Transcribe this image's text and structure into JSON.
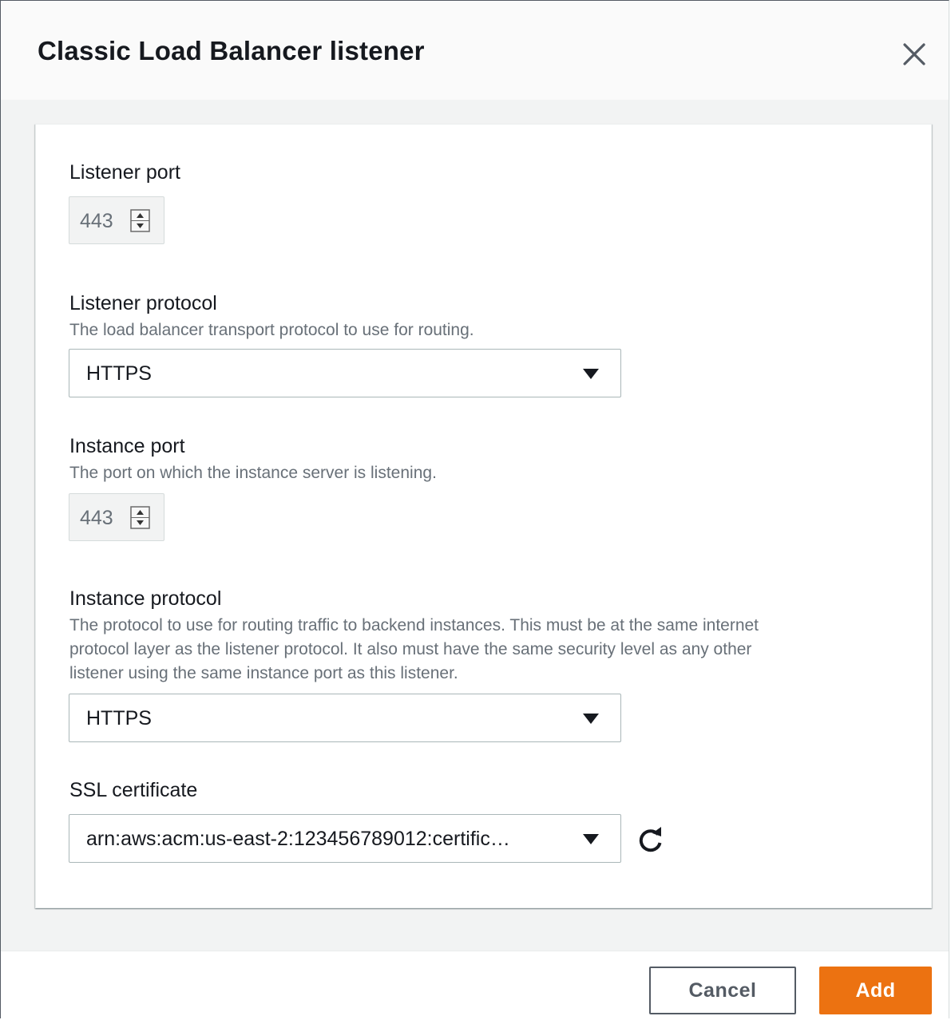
{
  "modal": {
    "title": "Classic Load Balancer listener"
  },
  "listener_port": {
    "label": "Listener port",
    "value": "443"
  },
  "listener_protocol": {
    "label": "Listener protocol",
    "description": "The load balancer transport protocol to use for routing.",
    "selected": "HTTPS"
  },
  "instance_port": {
    "label": "Instance port",
    "description": "The port on which the instance server is listening.",
    "value": "443"
  },
  "instance_protocol": {
    "label": "Instance protocol",
    "description_lines": [
      "The protocol to use for routing traffic to backend instances. This must be at the same internet",
      "protocol layer as the listener protocol. It also must have the same security level as any other",
      "listener using the same instance port as this listener."
    ],
    "selected": "HTTPS"
  },
  "ssl_certificate": {
    "label": "SSL certificate",
    "selected": "arn:aws:acm:us-east-2:123456789012:certific…"
  },
  "footer": {
    "cancel_label": "Cancel",
    "add_label": "Add"
  },
  "colors": {
    "primary_button": "#ec7211",
    "text": "#16191f",
    "secondary_text": "#687078",
    "body_background": "#f2f3f3"
  },
  "icons": [
    "close-icon",
    "stepper-arrows-icon",
    "caret-down-icon",
    "refresh-icon"
  ]
}
